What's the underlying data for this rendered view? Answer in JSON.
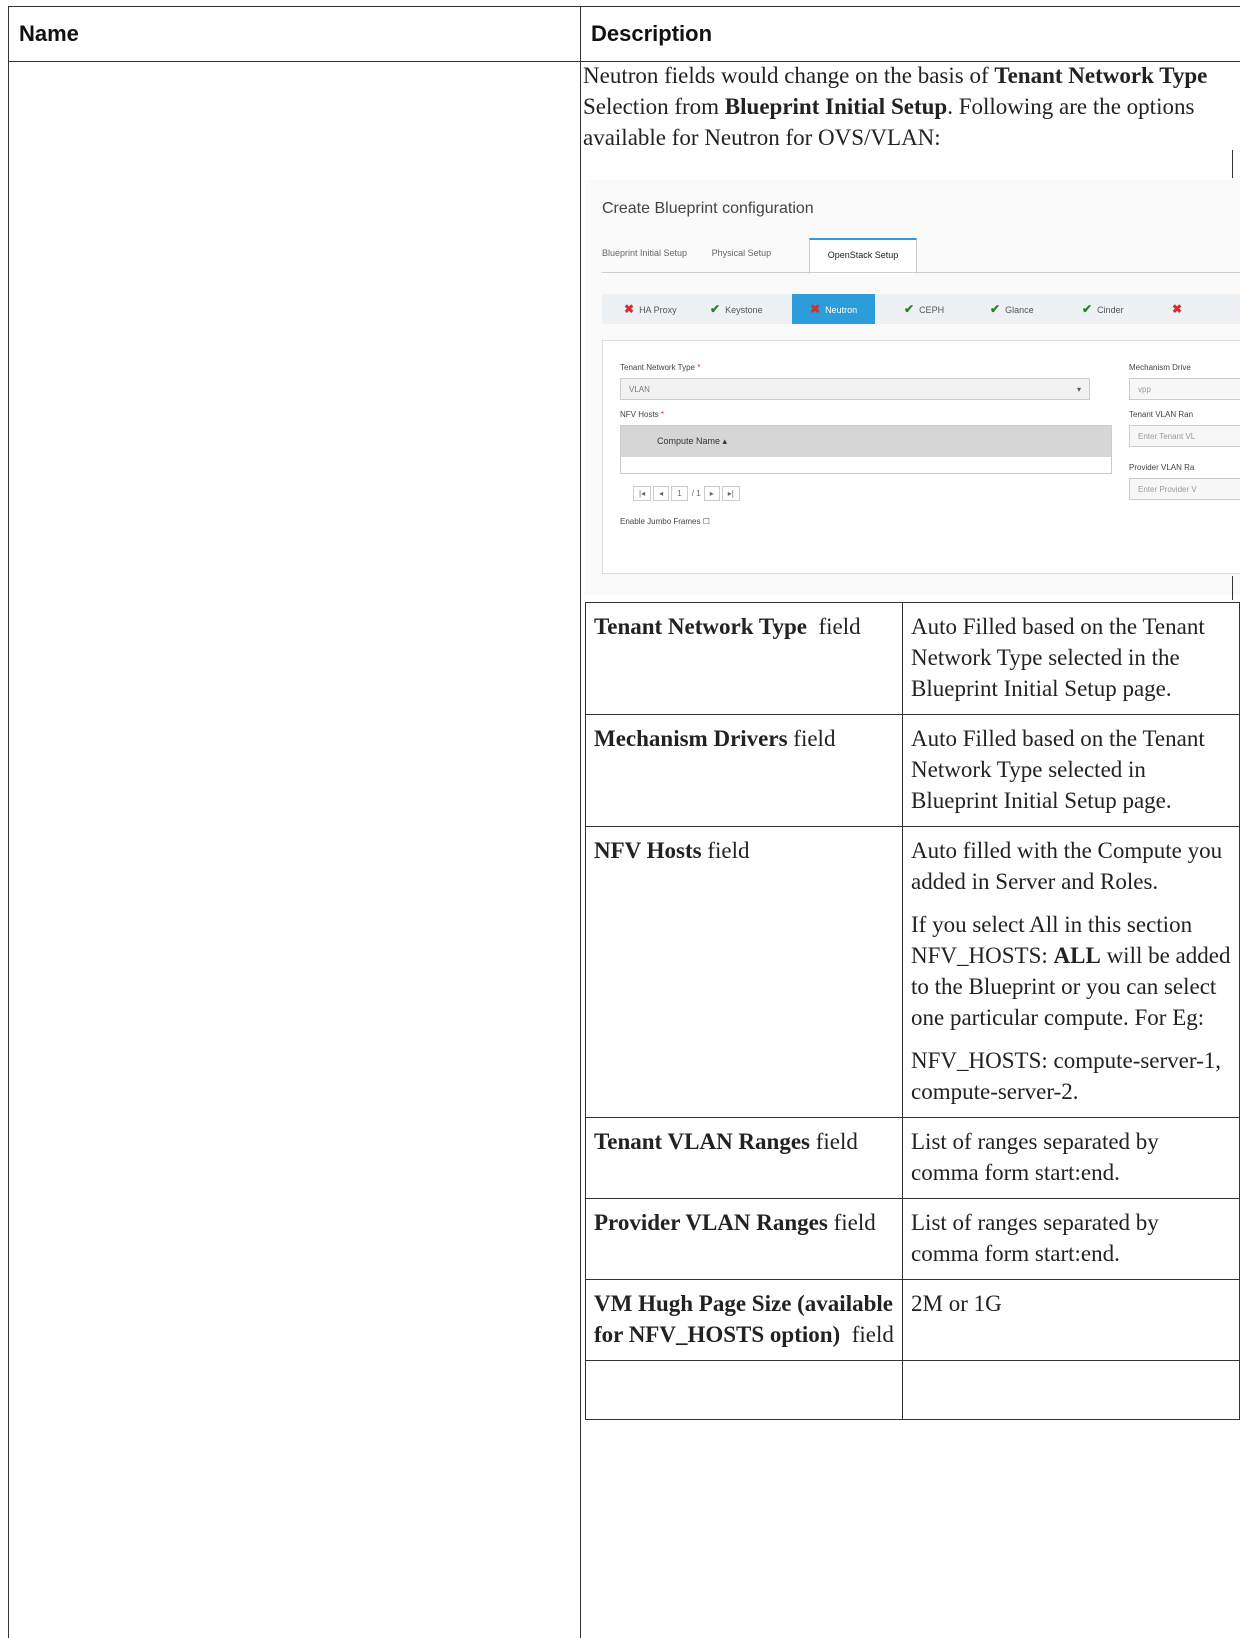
{
  "table": {
    "header_name": "Name",
    "header_description": "Description"
  },
  "intro": {
    "text1": "Neutron fields would change on the basis of ",
    "bold1": "Tenant Network Type",
    "text2": " Selection from ",
    "bold2": "Blueprint Initial Setup",
    "text3": ". Following are the options available for Neutron for OVS/VLAN:"
  },
  "screenshot": {
    "title": "Create Blueprint configuration",
    "tabs": [
      "Blueprint Initial Setup",
      "Physical Setup"
    ],
    "active_tab": "OpenStack Setup",
    "steps": [
      {
        "label": "HA Proxy",
        "status": "error"
      },
      {
        "label": "Keystone",
        "status": "ok"
      },
      {
        "label": "Neutron",
        "status": "error-active"
      },
      {
        "label": "CEPH",
        "status": "ok"
      },
      {
        "label": "Glance",
        "status": "ok"
      },
      {
        "label": "Cinder",
        "status": "ok"
      }
    ],
    "tenant_network_type_label": "Tenant Network Type",
    "tenant_network_type_value": "VLAN",
    "nfv_hosts_label": "NFV Hosts",
    "compute_name_col": "Compute Name",
    "pager_page": "1",
    "pager_of": "/ 1",
    "jumbo_label": "Enable Jumbo Frames",
    "mechanism_label": "Mechanism Drive",
    "mechanism_value": "vpp",
    "tenant_vlan_label": "Tenant VLAN Ran",
    "tenant_vlan_placeholder": "Enter Tenant VL",
    "provider_vlan_label": "Provider VLAN Ra",
    "provider_vlan_placeholder": "Enter Provider V"
  },
  "rows": [
    {
      "name_bold": "Tenant Network Type",
      "name_rest": "  field",
      "desc": [
        "Auto Filled based on the Tenant Network Type selected in the Blueprint Initial Setup page."
      ]
    },
    {
      "name_bold": "Mechanism Drivers",
      "name_rest": " field",
      "desc": [
        "Auto Filled based on the Tenant Network Type selected in Blueprint Initial Setup page."
      ]
    },
    {
      "name_bold": "NFV Hosts",
      "name_rest": " field",
      "desc": [
        "Auto filled with the Compute you added in Server and Roles."
      ],
      "desc2_pre": "If you select All in this section NFV_HOSTS: ",
      "desc2_bold": "ALL",
      "desc2_post": " will be added to the Blueprint or you can select one particular compute. For Eg:",
      "desc3": "NFV_HOSTS: compute-server-1, compute-server-2."
    },
    {
      "name_bold": "Tenant VLAN Ranges",
      "name_rest": " field",
      "desc": [
        "List of ranges separated by comma form start:end."
      ]
    },
    {
      "name_bold": "Provider VLAN Ranges",
      "name_rest": " field",
      "desc": [
        "List of ranges separated by comma form start:end."
      ]
    },
    {
      "name_bold": "VM Hugh Page Size (available for NFV_HOSTS option)",
      "name_rest": "  field",
      "desc": [
        "2M or 1G"
      ]
    }
  ]
}
